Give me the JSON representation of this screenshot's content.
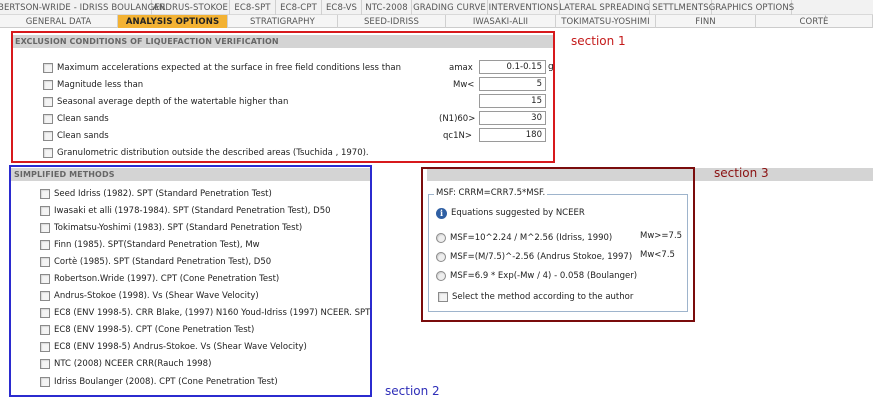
{
  "tabs_row1": [
    "ROBERTSON-WRIDE - IDRISS BOULANGER",
    "ANDRUS-STOKOE",
    "EC8-SPT",
    "EC8-CPT",
    "EC8-VS",
    "NTC-2008",
    "GRADING CURVE",
    "INTERVENTIONS",
    "LATERAL SPREADING",
    "SETTLMENTS",
    "GRAPHICS OPTIONS"
  ],
  "tabs_row2": [
    "GENERAL DATA",
    "ANALYSIS OPTIONS",
    "STRATIGRAPHY",
    "SEED-IDRISS",
    "IWASAKI-ALII",
    "TOKIMATSU-YOSHIMI",
    "FINN",
    "CORTÈ"
  ],
  "active_tab": "ANALYSIS OPTIONS",
  "exclusion": {
    "title": "EXCLUSION CONDITIONS OF LIQUEFACTION VERIFICATION",
    "rows": [
      {
        "label": "Maximum accelerations expected at the surface in free field conditions less than",
        "symbol": "amax",
        "value": "0.1-0.15",
        "unit": "g"
      },
      {
        "label": "Magnitude less than",
        "symbol": "Mw<",
        "value": "5"
      },
      {
        "label": "Seasonal average depth of the watertable higher than",
        "symbol": "",
        "value": "15"
      },
      {
        "label": "Clean sands",
        "symbol": "(N1)60>",
        "value": "30"
      },
      {
        "label": "Clean sands",
        "symbol": "qc1N>",
        "value": "180"
      },
      {
        "label": "Granulometric distribution outside the described areas (Tsuchida , 1970)."
      }
    ]
  },
  "simplified": {
    "title": "SIMPLIFIED METHODS",
    "items": [
      "Seed Idriss (1982). SPT (Standard Penetration Test)",
      "Iwasaki et alli (1978-1984). SPT (Standard Penetration Test), D50",
      "Tokimatsu-Yoshimi (1983). SPT (Standard Penetration Test)",
      "Finn (1985). SPT(Standard Penetration Test), Mw",
      "Cortè (1985). SPT (Standard Penetration Test), D50",
      "Robertson.Wride (1997). CPT (Cone Penetration Test)",
      "Andrus-Stokoe (1998). Vs (Shear Wave Velocity)",
      "EC8 (ENV 1998-5). CRR Blake, (1997) N160 Youd-Idriss (1997) NCEER. SPT",
      "EC8 (ENV 1998-5). CPT (Cone Penetration Test)",
      "EC8 (ENV 1998-5) Andrus-Stokoe. Vs (Shear Wave Velocity)",
      "NTC (2008) NCEER CRR(Rauch 1998)",
      "Idriss Boulanger (2008). CPT (Cone Penetration Test)"
    ]
  },
  "msf": {
    "title": "MSF: CRRM=CRR7.5*MSF.",
    "info": "Equations suggested by NCEER",
    "options": [
      {
        "formula": "MSF=10^2.24 / M^2.56 (Idriss, 1990)",
        "cond": "Mw>=7.5"
      },
      {
        "formula": "MSF=(M/7.5)^-2.56 (Andrus Stokoe, 1997)",
        "cond": "Mw<7.5"
      },
      {
        "formula": "MSF=6.9 * Exp(-Mw / 4) - 0.058 (Boulanger)",
        "cond": ""
      }
    ],
    "author_checkbox": "Select the method according to the author"
  },
  "annotations": {
    "section1": "section 1",
    "section2": "section 2",
    "section3": "section 3"
  },
  "colors": {
    "active_tab": "#f3b233",
    "section1_border": "#d7191c",
    "section2_border": "#2b2bcf",
    "section3_border": "#7a0c0c",
    "header_bg": "#d4d4d4"
  }
}
